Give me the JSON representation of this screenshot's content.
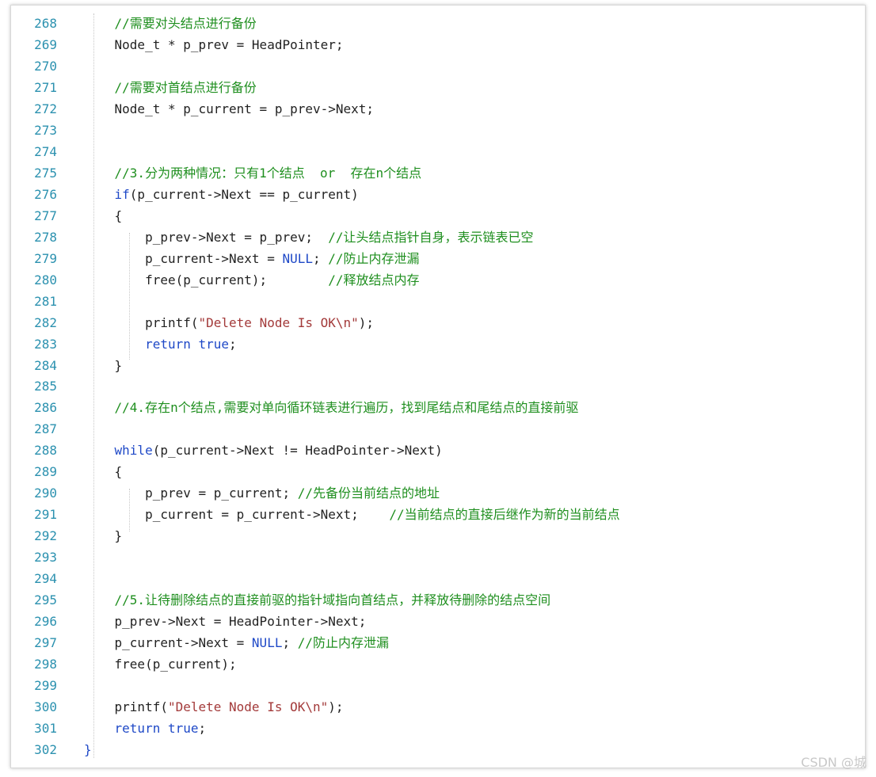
{
  "code_editor": {
    "lines": [
      {
        "no": "268",
        "segments": [
          {
            "t": "    //需要对头结点进行备份",
            "c": "c"
          }
        ]
      },
      {
        "no": "269",
        "segments": [
          {
            "t": "    Node_t * p_prev = HeadPointer;",
            "c": "p"
          }
        ]
      },
      {
        "no": "270",
        "segments": []
      },
      {
        "no": "271",
        "segments": [
          {
            "t": "    //需要对首结点进行备份",
            "c": "c"
          }
        ]
      },
      {
        "no": "272",
        "segments": [
          {
            "t": "    Node_t * p_current = p_prev->Next;",
            "c": "p"
          }
        ]
      },
      {
        "no": "273",
        "segments": []
      },
      {
        "no": "274",
        "segments": []
      },
      {
        "no": "275",
        "segments": [
          {
            "t": "    //3.分为两种情况：只有1个结点  or  存在n个结点",
            "c": "c"
          }
        ]
      },
      {
        "no": "276",
        "segments": [
          {
            "t": "    ",
            "c": "p"
          },
          {
            "t": "if",
            "c": "k"
          },
          {
            "t": "(p_current->Next == p_current)",
            "c": "p"
          }
        ]
      },
      {
        "no": "277",
        "segments": [
          {
            "t": "    {",
            "c": "p"
          }
        ]
      },
      {
        "no": "278",
        "segments": [
          {
            "t": "        p_prev->Next = p_prev;  ",
            "c": "p"
          },
          {
            "t": "//让头结点指针自身，表示链表已空",
            "c": "c"
          }
        ]
      },
      {
        "no": "279",
        "segments": [
          {
            "t": "        p_current->Next = ",
            "c": "p"
          },
          {
            "t": "NULL",
            "c": "k"
          },
          {
            "t": "; ",
            "c": "p"
          },
          {
            "t": "//防止内存泄漏",
            "c": "c"
          }
        ]
      },
      {
        "no": "280",
        "segments": [
          {
            "t": "        free(p_current);        ",
            "c": "p"
          },
          {
            "t": "//释放结点内存",
            "c": "c"
          }
        ]
      },
      {
        "no": "281",
        "segments": []
      },
      {
        "no": "282",
        "segments": [
          {
            "t": "        printf(",
            "c": "p"
          },
          {
            "t": "\"Delete Node Is OK\\n\"",
            "c": "s"
          },
          {
            "t": ");",
            "c": "p"
          }
        ]
      },
      {
        "no": "283",
        "segments": [
          {
            "t": "        ",
            "c": "p"
          },
          {
            "t": "return",
            "c": "k"
          },
          {
            "t": " ",
            "c": "p"
          },
          {
            "t": "true",
            "c": "k"
          },
          {
            "t": ";",
            "c": "p"
          }
        ]
      },
      {
        "no": "284",
        "segments": [
          {
            "t": "    }",
            "c": "p"
          }
        ]
      },
      {
        "no": "285",
        "segments": []
      },
      {
        "no": "286",
        "segments": [
          {
            "t": "    //4.存在n个结点,需要对单向循环链表进行遍历，找到尾结点和尾结点的直接前驱",
            "c": "c"
          }
        ]
      },
      {
        "no": "287",
        "segments": []
      },
      {
        "no": "288",
        "segments": [
          {
            "t": "    ",
            "c": "p"
          },
          {
            "t": "while",
            "c": "k"
          },
          {
            "t": "(p_current->Next != HeadPointer->Next)",
            "c": "p"
          }
        ]
      },
      {
        "no": "289",
        "segments": [
          {
            "t": "    {",
            "c": "p"
          }
        ]
      },
      {
        "no": "290",
        "segments": [
          {
            "t": "        p_prev = p_current; ",
            "c": "p"
          },
          {
            "t": "//先备份当前结点的地址",
            "c": "c"
          }
        ]
      },
      {
        "no": "291",
        "segments": [
          {
            "t": "        p_current = p_current->Next;    ",
            "c": "p"
          },
          {
            "t": "//当前结点的直接后继作为新的当前结点",
            "c": "c"
          }
        ]
      },
      {
        "no": "292",
        "segments": [
          {
            "t": "    }",
            "c": "p"
          }
        ]
      },
      {
        "no": "293",
        "segments": []
      },
      {
        "no": "294",
        "segments": []
      },
      {
        "no": "295",
        "segments": [
          {
            "t": "    //5.让待删除结点的直接前驱的指针域指向首结点，并释放待删除的结点空间",
            "c": "c"
          }
        ]
      },
      {
        "no": "296",
        "segments": [
          {
            "t": "    p_prev->Next = HeadPointer->Next;",
            "c": "p"
          }
        ]
      },
      {
        "no": "297",
        "segments": [
          {
            "t": "    p_current->Next = ",
            "c": "p"
          },
          {
            "t": "NULL",
            "c": "k"
          },
          {
            "t": "; ",
            "c": "p"
          },
          {
            "t": "//防止内存泄漏",
            "c": "c"
          }
        ]
      },
      {
        "no": "298",
        "segments": [
          {
            "t": "    free(p_current);",
            "c": "p"
          }
        ]
      },
      {
        "no": "299",
        "segments": []
      },
      {
        "no": "300",
        "segments": [
          {
            "t": "    printf(",
            "c": "p"
          },
          {
            "t": "\"Delete Node Is OK\\n\"",
            "c": "s"
          },
          {
            "t": ");",
            "c": "p"
          }
        ]
      },
      {
        "no": "301",
        "segments": [
          {
            "t": "    ",
            "c": "p"
          },
          {
            "t": "return",
            "c": "k"
          },
          {
            "t": " ",
            "c": "p"
          },
          {
            "t": "true",
            "c": "k"
          },
          {
            "t": ";",
            "c": "p"
          }
        ]
      },
      {
        "no": "302",
        "segments": [
          {
            "t": "}",
            "c": "k"
          }
        ]
      }
    ]
  },
  "colors": {
    "comment": "#1f8f1f",
    "keyword": "#1f49c7",
    "string": "#a33a3a",
    "plain": "#222222",
    "line_number": "#2b91af"
  },
  "watermark": "CSDN @城"
}
